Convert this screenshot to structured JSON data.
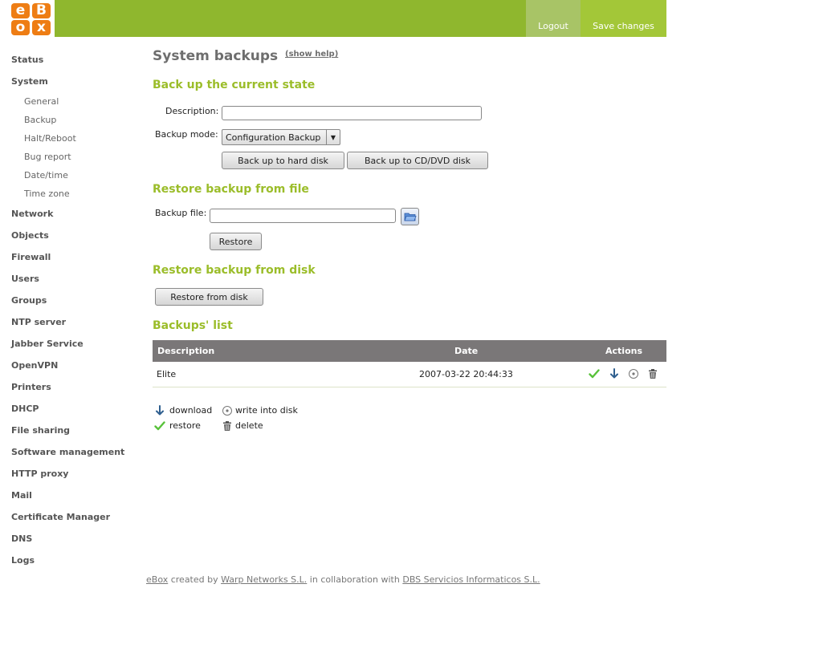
{
  "header": {
    "logo_letters": [
      "e",
      "B",
      "o",
      "x"
    ],
    "logout_label": "Logout",
    "save_label": "Save changes",
    "colors": {
      "bar": "#8fb72e",
      "logo": "#ee7d14"
    }
  },
  "sidebar": {
    "items": [
      {
        "label": "Status"
      },
      {
        "label": "System",
        "children": [
          {
            "label": "General"
          },
          {
            "label": "Backup"
          },
          {
            "label": "Halt/Reboot"
          },
          {
            "label": "Bug report"
          },
          {
            "label": "Date/time"
          },
          {
            "label": "Time zone"
          }
        ]
      },
      {
        "label": "Network"
      },
      {
        "label": "Objects"
      },
      {
        "label": "Firewall"
      },
      {
        "label": "Users"
      },
      {
        "label": "Groups"
      },
      {
        "label": "NTP server"
      },
      {
        "label": "Jabber Service"
      },
      {
        "label": "OpenVPN"
      },
      {
        "label": "Printers"
      },
      {
        "label": "DHCP"
      },
      {
        "label": "File sharing"
      },
      {
        "label": "Software management"
      },
      {
        "label": "HTTP proxy"
      },
      {
        "label": "Mail"
      },
      {
        "label": "Certificate Manager"
      },
      {
        "label": "DNS"
      },
      {
        "label": "Logs"
      }
    ]
  },
  "main": {
    "title": "System backups",
    "help_link": "(show help)",
    "backup_section": {
      "title": "Back up the current state",
      "description_label": "Description:",
      "description_value": "",
      "mode_label": "Backup mode:",
      "mode_value": "Configuration Backup",
      "btn_hard_disk": "Back up to hard disk",
      "btn_cd_dvd": "Back up to CD/DVD disk"
    },
    "restore_file_section": {
      "title": "Restore backup from file",
      "file_label": "Backup file:",
      "file_value": "",
      "restore_button": "Restore"
    },
    "restore_disk_section": {
      "title": "Restore backup from disk",
      "restore_button": "Restore from disk"
    },
    "list_section": {
      "title": "Backups' list",
      "columns": [
        "Description",
        "Date",
        "Actions"
      ],
      "rows": [
        {
          "description": "Elite",
          "date": "2007-03-22 20:44:33",
          "actions": [
            "restore-icon",
            "download-icon",
            "write-disk-icon",
            "delete-icon"
          ]
        }
      ]
    },
    "legend": {
      "download": "download",
      "write_disk": "write into disk",
      "restore": "restore",
      "delete": "delete"
    }
  },
  "footer": {
    "brand": "eBox",
    "created_by": "created by",
    "company": "Warp Networks S.L.",
    "collab": "in collaboration with",
    "partner": "DBS Servicios Informaticos S.L."
  }
}
